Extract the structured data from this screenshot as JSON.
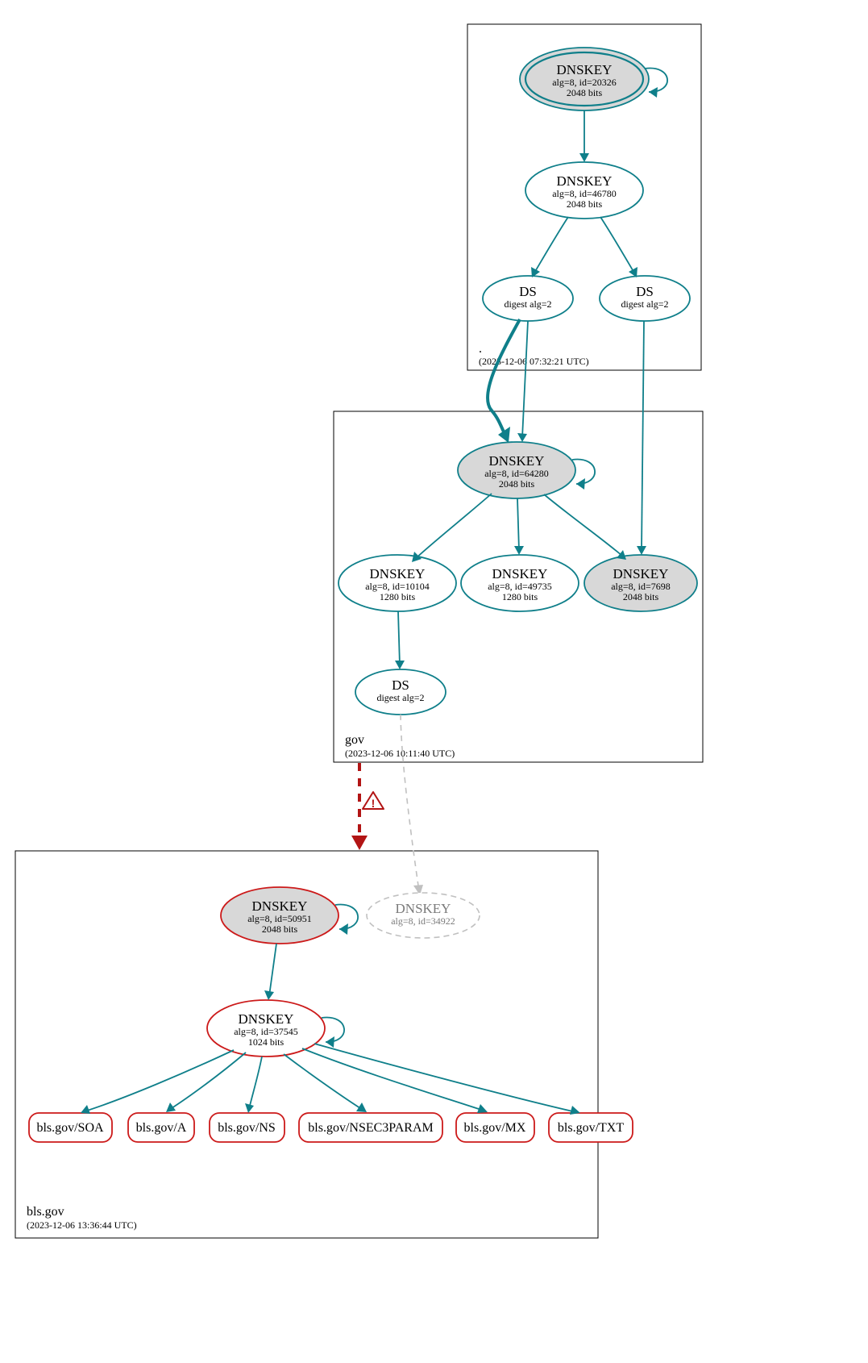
{
  "colors": {
    "teal": "#0f7f8a",
    "red": "#cc1a1a",
    "warn_red": "#b21414",
    "gray": "#c0c0c0",
    "node_fill": "#d8d8d8"
  },
  "zones": {
    "root": {
      "label": ".",
      "timestamp": "(2023-12-06 07:32:21 UTC)",
      "nodes": {
        "ksk": {
          "title": "DNSKEY",
          "line2": "alg=8, id=20326",
          "line3": "2048 bits"
        },
        "zsk": {
          "title": "DNSKEY",
          "line2": "alg=8, id=46780",
          "line3": "2048 bits"
        },
        "ds1": {
          "title": "DS",
          "line2": "digest alg=2"
        },
        "ds2": {
          "title": "DS",
          "line2": "digest alg=2"
        }
      }
    },
    "gov": {
      "label": "gov",
      "timestamp": "(2023-12-06 10:11:40 UTC)",
      "nodes": {
        "ksk": {
          "title": "DNSKEY",
          "line2": "alg=8, id=64280",
          "line3": "2048 bits"
        },
        "zsk1": {
          "title": "DNSKEY",
          "line2": "alg=8, id=10104",
          "line3": "1280 bits"
        },
        "zsk2": {
          "title": "DNSKEY",
          "line2": "alg=8, id=49735",
          "line3": "1280 bits"
        },
        "key7698": {
          "title": "DNSKEY",
          "line2": "alg=8, id=7698",
          "line3": "2048 bits"
        },
        "ds": {
          "title": "DS",
          "line2": "digest alg=2"
        }
      }
    },
    "blsgov": {
      "label": "bls.gov",
      "timestamp": "(2023-12-06 13:36:44 UTC)",
      "nodes": {
        "ksk": {
          "title": "DNSKEY",
          "line2": "alg=8, id=50951",
          "line3": "2048 bits"
        },
        "zsk": {
          "title": "DNSKEY",
          "line2": "alg=8, id=37545",
          "line3": "1024 bits"
        },
        "dash": {
          "title": "DNSKEY",
          "line2": "alg=8, id=34922"
        }
      },
      "rrsets": {
        "soa": "bls.gov/SOA",
        "a": "bls.gov/A",
        "ns": "bls.gov/NS",
        "nsec3": "bls.gov/NSEC3PARAM",
        "mx": "bls.gov/MX",
        "txt": "bls.gov/TXT"
      }
    }
  },
  "chart_data": {
    "type": "dnssec-delegation-graph",
    "zones": [
      {
        "name": ".",
        "timestamp": "2023-12-06 07:32:21 UTC",
        "keys": [
          {
            "type": "DNSKEY",
            "alg": 8,
            "id": 20326,
            "bits": 2048,
            "role": "KSK",
            "trust_anchor": true
          },
          {
            "type": "DNSKEY",
            "alg": 8,
            "id": 46780,
            "bits": 2048,
            "role": "ZSK"
          }
        ],
        "ds": [
          {
            "digest_alg": 2,
            "target_zone": "gov",
            "matches_key_id": 64280
          },
          {
            "digest_alg": 2,
            "target_zone": "gov",
            "matches_key_id": 7698
          }
        ]
      },
      {
        "name": "gov",
        "timestamp": "2023-12-06 10:11:40 UTC",
        "keys": [
          {
            "type": "DNSKEY",
            "alg": 8,
            "id": 64280,
            "bits": 2048,
            "role": "KSK"
          },
          {
            "type": "DNSKEY",
            "alg": 8,
            "id": 10104,
            "bits": 1280,
            "role": "ZSK"
          },
          {
            "type": "DNSKEY",
            "alg": 8,
            "id": 49735,
            "bits": 1280,
            "role": "ZSK"
          },
          {
            "type": "DNSKEY",
            "alg": 8,
            "id": 7698,
            "bits": 2048,
            "role": "KSK-standby"
          }
        ],
        "ds": [
          {
            "digest_alg": 2,
            "target_zone": "bls.gov",
            "matches_key_id": 34922,
            "status": "no-matching-key"
          }
        ]
      },
      {
        "name": "bls.gov",
        "timestamp": "2023-12-06 13:36:44 UTC",
        "keys": [
          {
            "type": "DNSKEY",
            "alg": 8,
            "id": 50951,
            "bits": 2048,
            "role": "KSK",
            "status": "bogus"
          },
          {
            "type": "DNSKEY",
            "alg": 8,
            "id": 37545,
            "bits": 1024,
            "role": "ZSK",
            "status": "bogus"
          },
          {
            "type": "DNSKEY",
            "alg": 8,
            "id": 34922,
            "status": "not-in-dnskey-rrset"
          }
        ],
        "rrsets": [
          {
            "name": "bls.gov",
            "type": "SOA",
            "status": "bogus"
          },
          {
            "name": "bls.gov",
            "type": "A",
            "status": "bogus"
          },
          {
            "name": "bls.gov",
            "type": "NS",
            "status": "bogus"
          },
          {
            "name": "bls.gov",
            "type": "NSEC3PARAM",
            "status": "bogus"
          },
          {
            "name": "bls.gov",
            "type": "MX",
            "status": "bogus"
          },
          {
            "name": "bls.gov",
            "type": "TXT",
            "status": "bogus"
          }
        ],
        "delegation_status": "bogus",
        "delegation_warning": true
      }
    ]
  }
}
